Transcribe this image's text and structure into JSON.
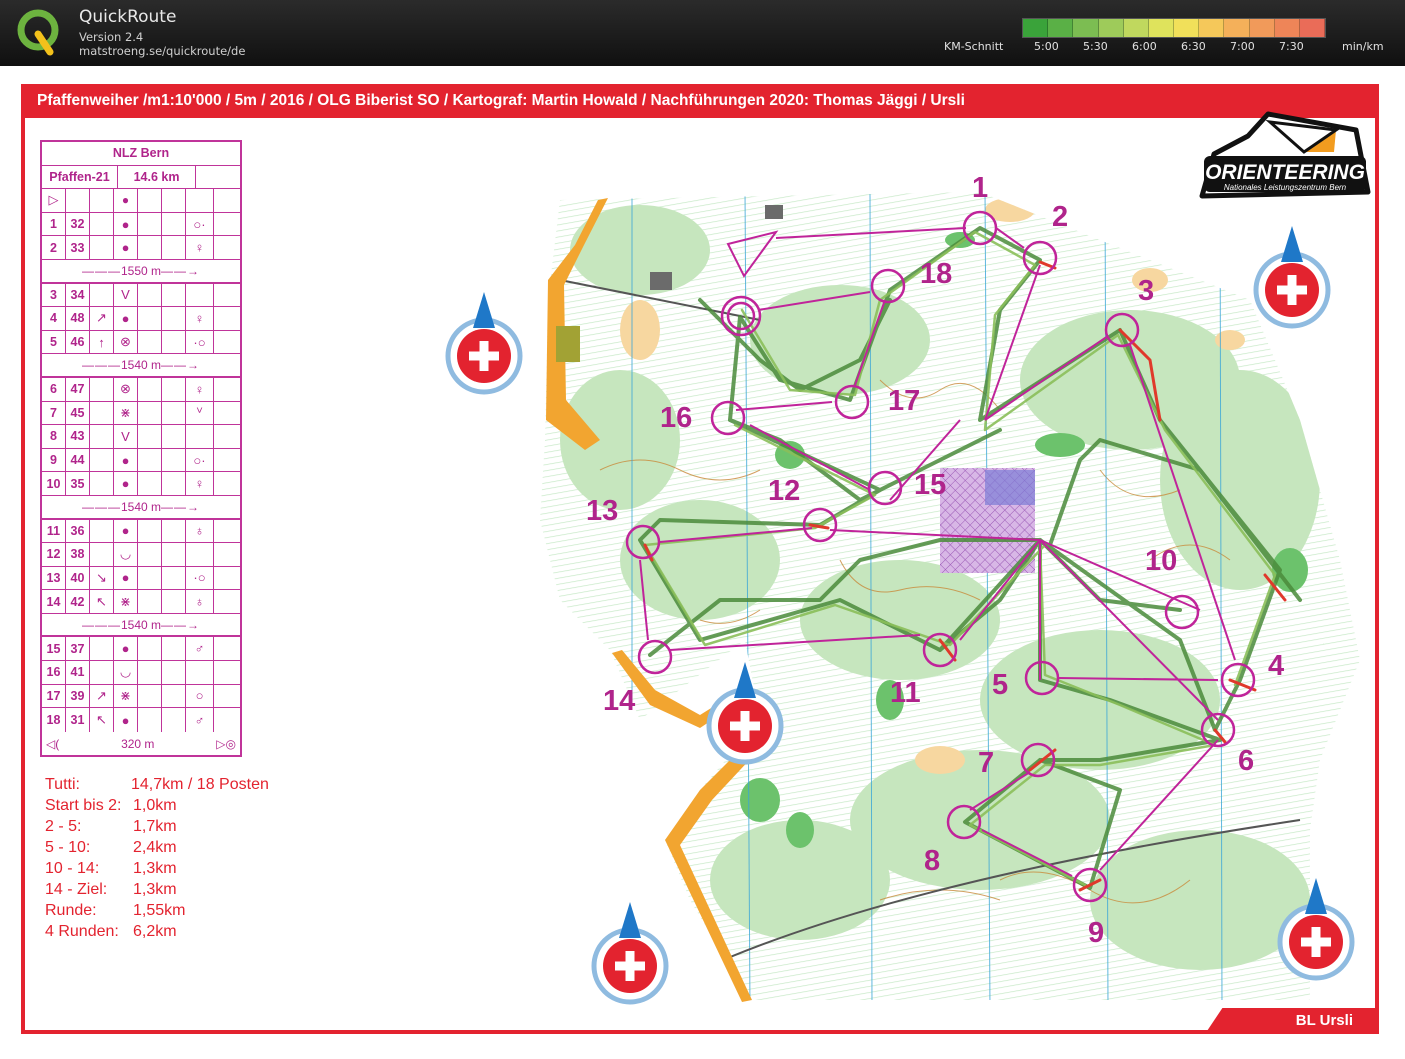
{
  "app": {
    "title": "QuickRoute",
    "version": "Version 2.4",
    "url": "matstroeng.se/quickroute/de",
    "logo_icon": "quickroute-q-logo"
  },
  "pace_legend": {
    "label": "KM-Schnitt",
    "ticks": [
      "5:00",
      "5:30",
      "6:00",
      "6:30",
      "7:00",
      "7:30"
    ],
    "unit": "min/km",
    "colors": [
      "#3aa33a",
      "#5ab046",
      "#7cbd52",
      "#9ecb5a",
      "#c0d85e",
      "#dfe35c",
      "#f1e05a",
      "#f5c85a",
      "#f4b05a",
      "#f19a5a",
      "#ee8558",
      "#ea6c58"
    ]
  },
  "map": {
    "title": "Pfaffenweiher /m1:10'000 / 5m / 2016 / OLG Biberist SO / Kartograf: Martin Howald / Nachführungen 2020: Thomas Jäggi / Ursli",
    "footer": "BL Ursli",
    "frame_color": "#e3232f",
    "course_color": "#b0248b",
    "badge": {
      "name": "ORIENTEERING",
      "subtitle": "Nationales Leistungszentrum Bern"
    },
    "controls": [
      "1",
      "2",
      "3",
      "4",
      "5",
      "6",
      "7",
      "8",
      "9",
      "10",
      "11",
      "12",
      "13",
      "14",
      "15",
      "16",
      "17",
      "18"
    ],
    "north_arrow_icon": "north-arrow-swiss-cross-icon"
  },
  "control_description": {
    "event": "NLZ Bern",
    "course": "Pfaffen-21",
    "length": "14.6 km",
    "start_symbol": "▷",
    "rows": [
      {
        "n": "1",
        "code": "32",
        "dir": "",
        "feat": "●",
        "pos": "○·"
      },
      {
        "n": "2",
        "code": "33",
        "dir": "",
        "feat": "●",
        "pos": "♀"
      },
      {
        "leg": "1550 m"
      },
      {
        "n": "3",
        "code": "34",
        "dir": "",
        "feat": "V",
        "pos": ""
      },
      {
        "n": "4",
        "code": "48",
        "dir": "↗",
        "feat": "●",
        "pos": "♀"
      },
      {
        "n": "5",
        "code": "46",
        "dir": "↑",
        "feat": "⊗",
        "pos": "·○"
      },
      {
        "leg": "1540 m"
      },
      {
        "n": "6",
        "code": "47",
        "dir": "",
        "feat": "⊗",
        "pos": "♀"
      },
      {
        "n": "7",
        "code": "45",
        "dir": "",
        "feat": "⋇",
        "pos": "ⱽ"
      },
      {
        "n": "8",
        "code": "43",
        "dir": "",
        "feat": "V",
        "pos": ""
      },
      {
        "n": "9",
        "code": "44",
        "dir": "",
        "feat": "●",
        "pos": "○·"
      },
      {
        "n": "10",
        "code": "35",
        "dir": "",
        "feat": "●",
        "pos": "♀"
      },
      {
        "leg": "1540 m"
      },
      {
        "n": "11",
        "code": "36",
        "dir": "",
        "feat": "●",
        "pos": "♁"
      },
      {
        "n": "12",
        "code": "38",
        "dir": "",
        "feat": "◡",
        "pos": ""
      },
      {
        "n": "13",
        "code": "40",
        "dir": "↘",
        "feat": "●",
        "pos": "·○"
      },
      {
        "n": "14",
        "code": "42",
        "dir": "↖",
        "feat": "⋇",
        "pos": "♁"
      },
      {
        "leg": "1540 m"
      },
      {
        "n": "15",
        "code": "37",
        "dir": "",
        "feat": "●",
        "pos": "♂"
      },
      {
        "n": "16",
        "code": "41",
        "dir": "",
        "feat": "◡",
        "pos": ""
      },
      {
        "n": "17",
        "code": "39",
        "dir": "↗",
        "feat": "⋇",
        "pos": "○"
      },
      {
        "n": "18",
        "code": "31",
        "dir": "↖",
        "feat": "●",
        "pos": "♂"
      }
    ],
    "finish": "320 m"
  },
  "stats": [
    {
      "label": "Tutti:",
      "value": "14,7km / 18 Posten"
    },
    {
      "label": "Start bis 2:",
      "value": "1,0km"
    },
    {
      "label": "2 - 5:",
      "value": "1,7km"
    },
    {
      "label": "5 - 10:",
      "value": "2,4km"
    },
    {
      "label": "10 - 14:",
      "value": "1,3km"
    },
    {
      "label": "14 - Ziel:",
      "value": "1,3km"
    },
    {
      "label": "Runde:",
      "value": "1,55km"
    },
    {
      "label": "4 Runden:",
      "value": "6,2km"
    }
  ]
}
